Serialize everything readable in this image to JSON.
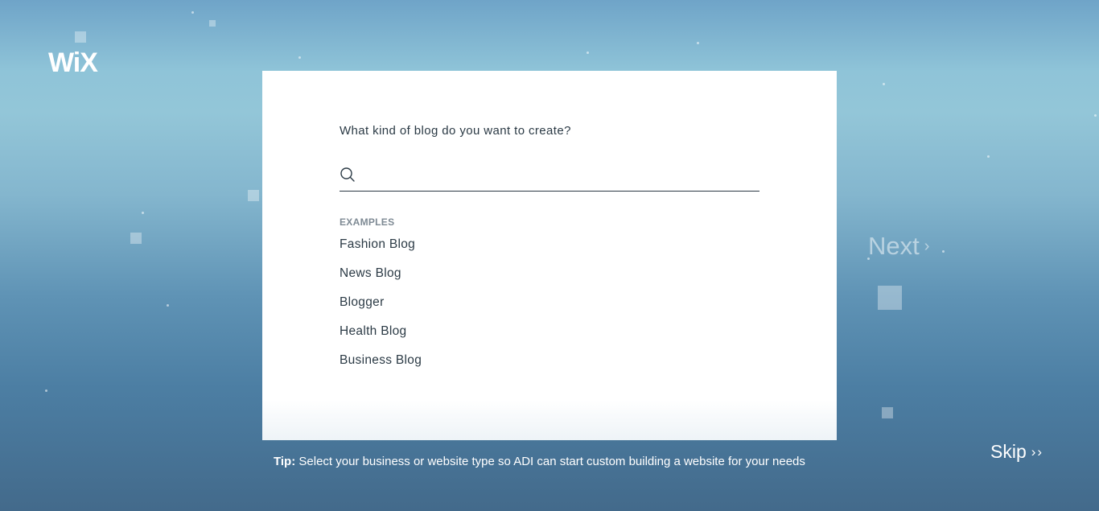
{
  "brand": {
    "logo_text": "WiX"
  },
  "card": {
    "question": "What kind of blog do you want to create?",
    "search": {
      "value": "",
      "placeholder": ""
    },
    "examples_heading": "EXAMPLES",
    "examples": [
      "Fashion Blog",
      "News Blog",
      "Blogger",
      "Health Blog",
      "Business Blog"
    ]
  },
  "tip": {
    "label": "Tip:",
    "text": "Select your business or website type so ADI can start custom building a website for your needs"
  },
  "nav": {
    "next_label": "Next",
    "next_chevron": "›",
    "skip_label": "Skip",
    "skip_chevron": "››"
  },
  "colors": {
    "card_background": "#ffffff",
    "text_dark": "#2b3a45",
    "text_muted": "#7e8a94",
    "background_top": "#6fa4c8",
    "background_bottom": "#436a8b"
  },
  "icons": {
    "search": "search-icon"
  }
}
